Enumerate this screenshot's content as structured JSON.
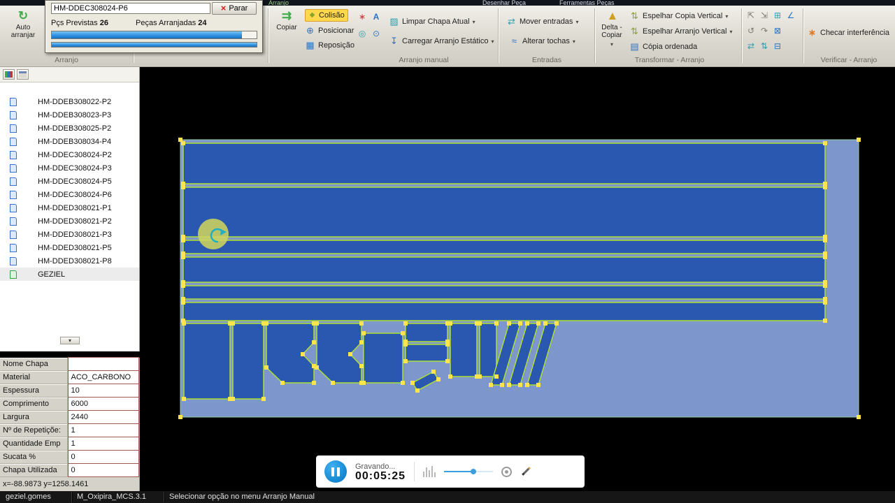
{
  "colors": {
    "ribbon-bg-top": "#f1efe9",
    "ribbon-bg-bottom": "#cfccc3",
    "group-label": "#6a695f",
    "canvas-bg": "#000000",
    "sheet-fill": "#7d97cd",
    "part-fill": "#2a57b0",
    "part-stroke": "#aee032",
    "marker": "#ffe44d",
    "colisao-bg": "#ffd84d",
    "status-bg": "#161616",
    "table-border": "#9f584e",
    "progress-fill": "#2d8fe0",
    "record-accent": "#1587d0",
    "highlight-circle": "#cdd45e"
  },
  "menubar": {
    "items": [
      {
        "label": "Arranjo"
      },
      {
        "label": "Desenhar Peça"
      },
      {
        "label": "Ferramentas Peças"
      }
    ]
  },
  "dialog": {
    "part_field": "HM-DDEC308024-P6",
    "stop_label": "Parar",
    "previstas_label": "Pçs Previstas",
    "previstas_value": "26",
    "arranjadas_label": "Peças Arranjadas",
    "arranjadas_value": "24",
    "progress_main_pct": 93,
    "progress_sub_pct": 100
  },
  "ribbon": {
    "auto_arranjar": "Auto arranjar",
    "copiar": "Copiar",
    "colisao": "Colisão",
    "posicionar": "Posicionar",
    "reposicao": "Reposição",
    "limpar_chapa": "Limpar Chapa Atual",
    "carregar_estatico": "Carregar Arranjo Estático",
    "mover_entradas": "Mover entradas",
    "alterar_tochas": "Alterar tochas",
    "delta_copiar": "Delta - Copiar",
    "espelhar_copia": "Espelhar Copia Vertical",
    "espelhar_arranjo": "Espelhar Arranjo Vertical",
    "copia_ordenada": "Cópia ordenada",
    "checar_interferencia": "Checar interferência",
    "groups": [
      {
        "label": "Arranjo"
      },
      {
        "label": "Arranjo manual"
      },
      {
        "label": "Entradas"
      },
      {
        "label": "Transformar - Arranjo"
      },
      {
        "label": "Verificar - Arranjo"
      }
    ]
  },
  "icons": {
    "auto_arranjar": "↻",
    "copiar": "⇉",
    "colisao": "◆",
    "posicionar": "⊕",
    "reposicao": "▦",
    "cluster_a": "∗",
    "cluster_b": "A",
    "cluster_c": "◎",
    "cluster_d": "⊙",
    "limpar": "▨",
    "carregar": "↧",
    "mover": "⇄",
    "tochas": "≈",
    "delta": "▲",
    "espelhar1": "⇅",
    "espelhar2": "⇅",
    "ordenada": "▤",
    "checar": "∗",
    "dropdown": "▾",
    "collapse": "▾",
    "close": "×",
    "grid": [
      "⇱",
      "⇲",
      "⊞",
      "∠",
      "↺",
      "↷",
      "⊠",
      "⇄",
      "⇅",
      "⊟"
    ]
  },
  "sidebar": {
    "items": [
      {
        "label": "HM-DDEB308022-P2"
      },
      {
        "label": "HM-DDEB308023-P3"
      },
      {
        "label": "HM-DDEB308025-P2"
      },
      {
        "label": "HM-DDEB308034-P4"
      },
      {
        "label": "HM-DDEC308024-P2"
      },
      {
        "label": "HM-DDEC308024-P3"
      },
      {
        "label": "HM-DDEC308024-P5"
      },
      {
        "label": "HM-DDEC308024-P6"
      },
      {
        "label": "HM-DDED308021-P1"
      },
      {
        "label": "HM-DDED308021-P2"
      },
      {
        "label": "HM-DDED308021-P3"
      },
      {
        "label": "HM-DDED308021-P5"
      },
      {
        "label": "HM-DDED308021-P8"
      },
      {
        "label": "GEZIEL"
      }
    ]
  },
  "properties": {
    "rows": [
      {
        "label": "Nome Chapa",
        "value": ""
      },
      {
        "label": "Material",
        "value": "ACO_CARBONO"
      },
      {
        "label": "Espessura",
        "value": "10"
      },
      {
        "label": "Comprimento",
        "value": "6000"
      },
      {
        "label": "Largura",
        "value": "2440"
      },
      {
        "label": "Nº de Repetiçõe:",
        "value": "1"
      },
      {
        "label": "Quantidade Emp",
        "value": "1"
      },
      {
        "label": "Sucata %",
        "value": "0"
      },
      {
        "label": "Chapa Utilizada",
        "value": "0"
      }
    ],
    "coords": "x=-88.9873 y=1258.1461"
  },
  "statusbar": {
    "user": "geziel.gomes",
    "profile": "M_Oxipira_MCS.3.1",
    "hint": "Selecionar opção no menu Arranjo Manual"
  },
  "recorder": {
    "status": "Gravando...",
    "time": "00:05:25",
    "slider_pct": 60
  }
}
